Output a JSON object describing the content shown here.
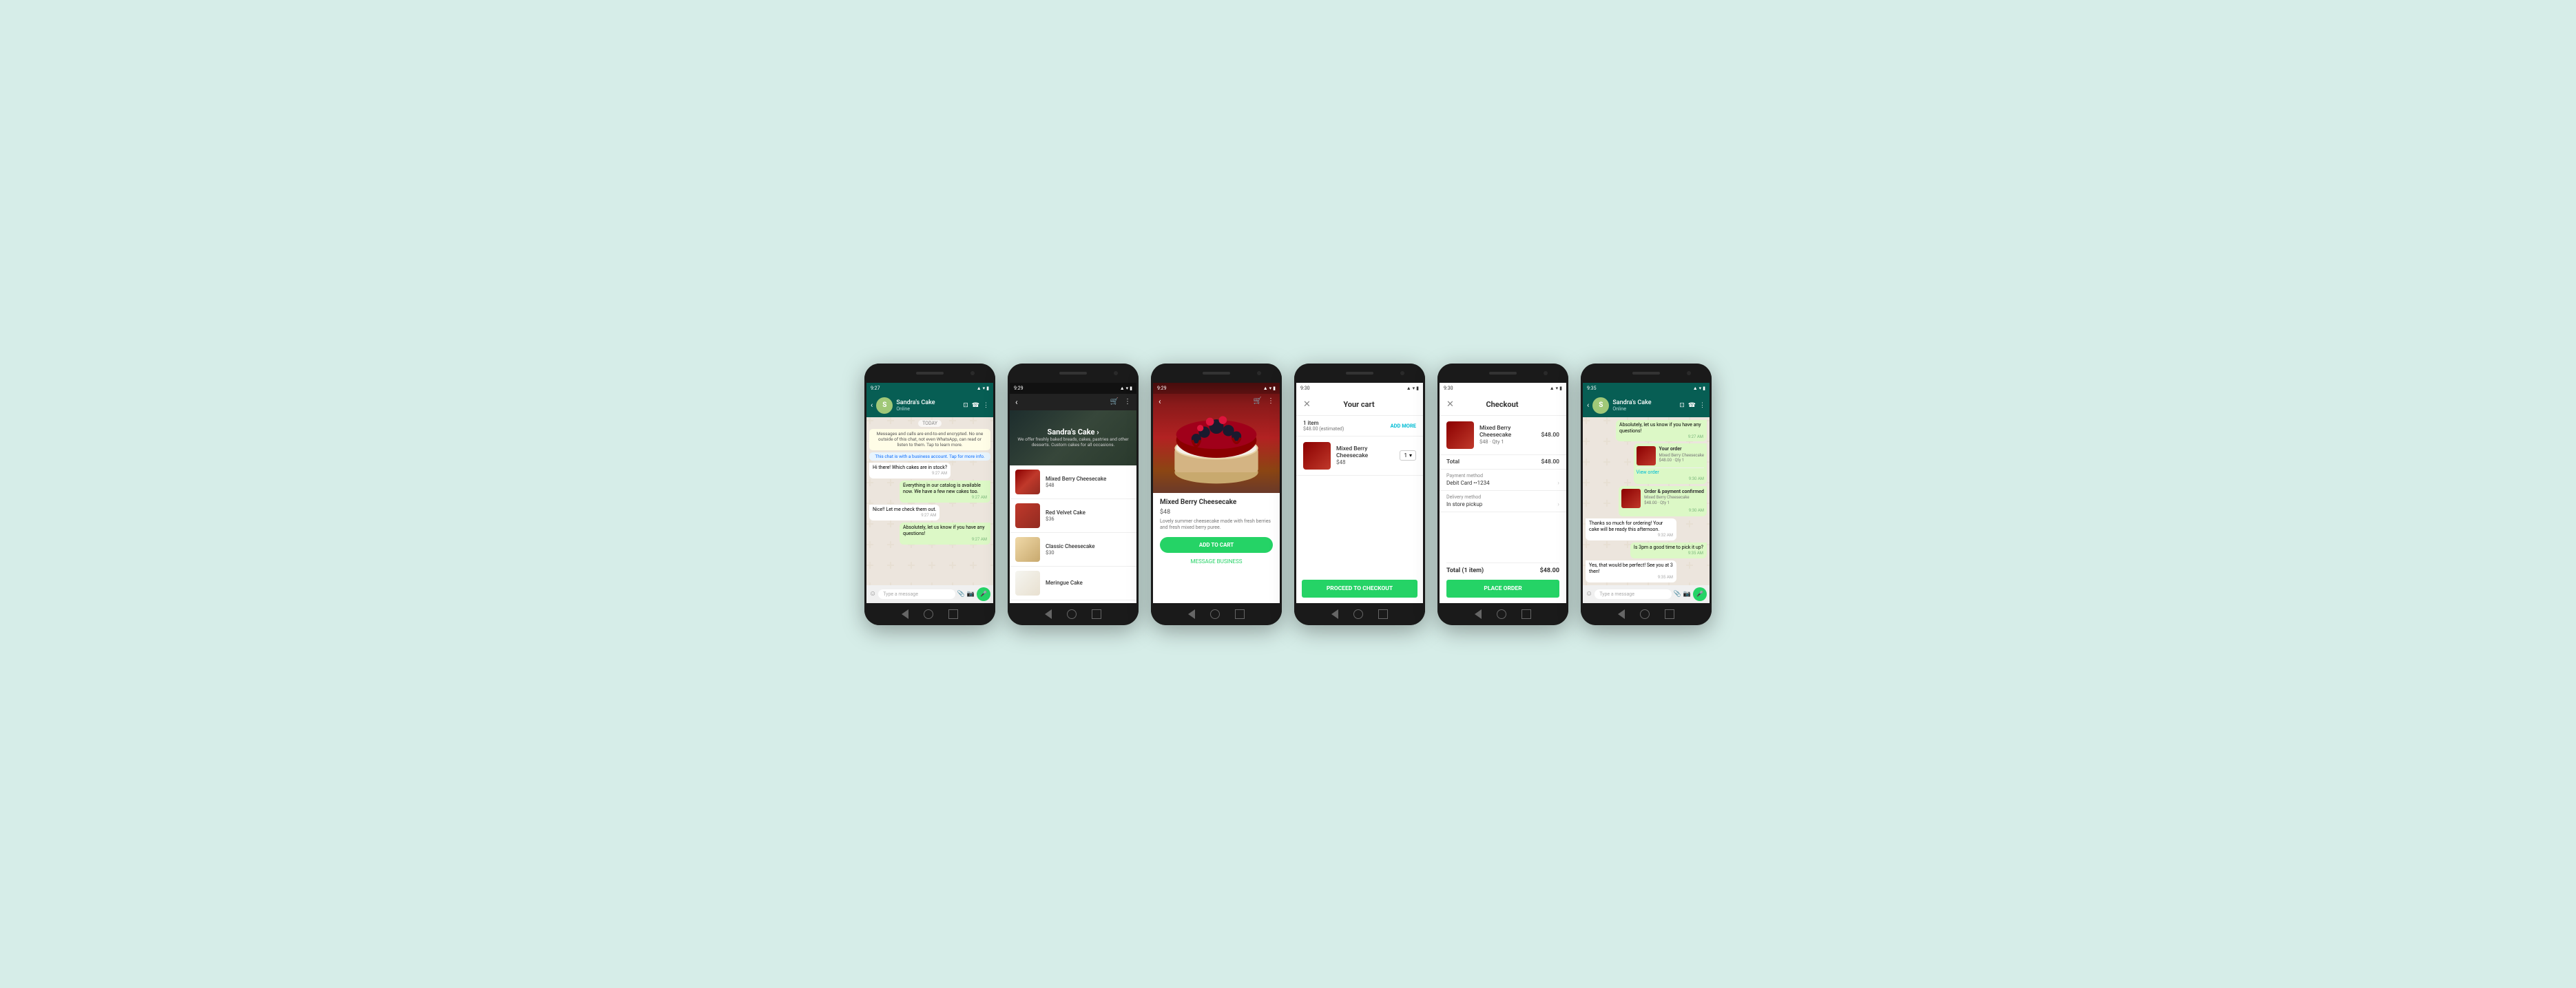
{
  "bg_color": "#d6ede8",
  "phones": [
    {
      "id": "phone1",
      "type": "whatsapp_chat",
      "status_bar": {
        "time": "9:27",
        "icons": "signal wifi battery"
      },
      "header": {
        "title": "Sandra's Cake",
        "status": "Online",
        "icons": [
          "video",
          "phone",
          "more"
        ]
      },
      "messages": [
        {
          "type": "date_divider",
          "text": "TODAY"
        },
        {
          "type": "system",
          "text": "Messages and calls are end-to-end encrypted. No one outside of this chat, not even WhatsApp, can read or listen to them. Tap to learn more."
        },
        {
          "type": "system_blue",
          "text": "This chat is with a business account. Tap for more info."
        },
        {
          "type": "received",
          "text": "Hi there! Which cakes are in stock?",
          "time": "9:27 AM"
        },
        {
          "type": "sent",
          "text": "Everything in our catalog is available now. We have a few new cakes too.",
          "time": "9:27 AM"
        },
        {
          "type": "received",
          "text": "Nice!! Let me check them out.",
          "time": "9:27 AM"
        },
        {
          "type": "sent",
          "text": "Absolutely, let us know if you have any questions!",
          "time": "9:27 AM"
        }
      ],
      "input_placeholder": "Type a message"
    },
    {
      "id": "phone2",
      "type": "catalog",
      "status_bar": {
        "time": "9:29"
      },
      "hero": {
        "name": "Sandra's Cake ›",
        "desc": "We offer freshly baked breads, cakes, pastries and other desserts. Custom cakes for all occasions."
      },
      "items": [
        {
          "name": "Mixed Berry Cheesecake",
          "price": "$48"
        },
        {
          "name": "Red Velvet Cake",
          "price": "$36"
        },
        {
          "name": "Classic Cheesecake",
          "price": "$30"
        },
        {
          "name": "Meringue Cake",
          "price": ""
        }
      ]
    },
    {
      "id": "phone3",
      "type": "product_detail",
      "status_bar": {
        "time": "9:29"
      },
      "product": {
        "name": "Mixed Berry Cheesecake",
        "price": "$48",
        "desc": "Lovely summer cheesecake made with fresh berries and fresh mixed berry puree.",
        "add_to_cart": "ADD TO CART",
        "message_business": "MESSAGE BUSINESS"
      }
    },
    {
      "id": "phone4",
      "type": "cart",
      "status_bar": {
        "time": "9:30"
      },
      "header": {
        "title": "Your cart",
        "close": "✕"
      },
      "summary": {
        "count": "1 item",
        "estimated": "$48.00 (estimated)",
        "add_more": "ADD MORE"
      },
      "items": [
        {
          "name": "Mixed Berry Cheesecake",
          "price": "$48",
          "qty": "1"
        }
      ],
      "proceed_btn": "PROCEED TO CHECKOUT"
    },
    {
      "id": "phone5",
      "type": "checkout",
      "status_bar": {
        "time": "9:30"
      },
      "header": {
        "title": "Checkout",
        "close": "✕"
      },
      "item": {
        "name": "Mixed Berry Cheesecake",
        "detail": "$48 · Qty 1",
        "price": "$48.00"
      },
      "total_row": {
        "label": "Total",
        "value": "$48.00"
      },
      "payment_method": {
        "label": "Payment method",
        "value": "Debit Card ••1234"
      },
      "delivery_method": {
        "label": "Delivery method",
        "value": "In store pickup"
      },
      "total_final": {
        "label": "Total (1 item)",
        "value": "$48.00"
      },
      "place_order_btn": "PLACE ORDER"
    },
    {
      "id": "phone6",
      "type": "whatsapp_order_confirmed",
      "status_bar": {
        "time": "9:35"
      },
      "header": {
        "title": "Sandra's Cake",
        "status": "Online"
      },
      "messages": [
        {
          "type": "sent",
          "text": "Absolutely, let us know if you have any questions!",
          "time": "9:27 AM"
        },
        {
          "type": "order_card_sent",
          "title": "Your order",
          "detail": "Mixed Berry Cheesecake\n$48.00 · Qty 1",
          "time": "9:30 AM",
          "view_order": "View order"
        },
        {
          "type": "order_confirmed_sent",
          "title": "Order & payment confirmed",
          "detail": "Mixed Berry Cheesecake\n$48.00 · Qty 1",
          "time": "9:30 AM"
        },
        {
          "type": "received",
          "text": "Thanks so much for ordering! Your cake will be ready this afternoon.",
          "time": "9:32 AM"
        },
        {
          "type": "sent",
          "text": "Is 3pm a good time to pick it up?",
          "time": "9:35 AM"
        },
        {
          "type": "received",
          "text": "Yes, that would be perfect! See you at 3 then!",
          "time": "9:35 AM"
        }
      ],
      "input_placeholder": "Type a message"
    }
  ]
}
